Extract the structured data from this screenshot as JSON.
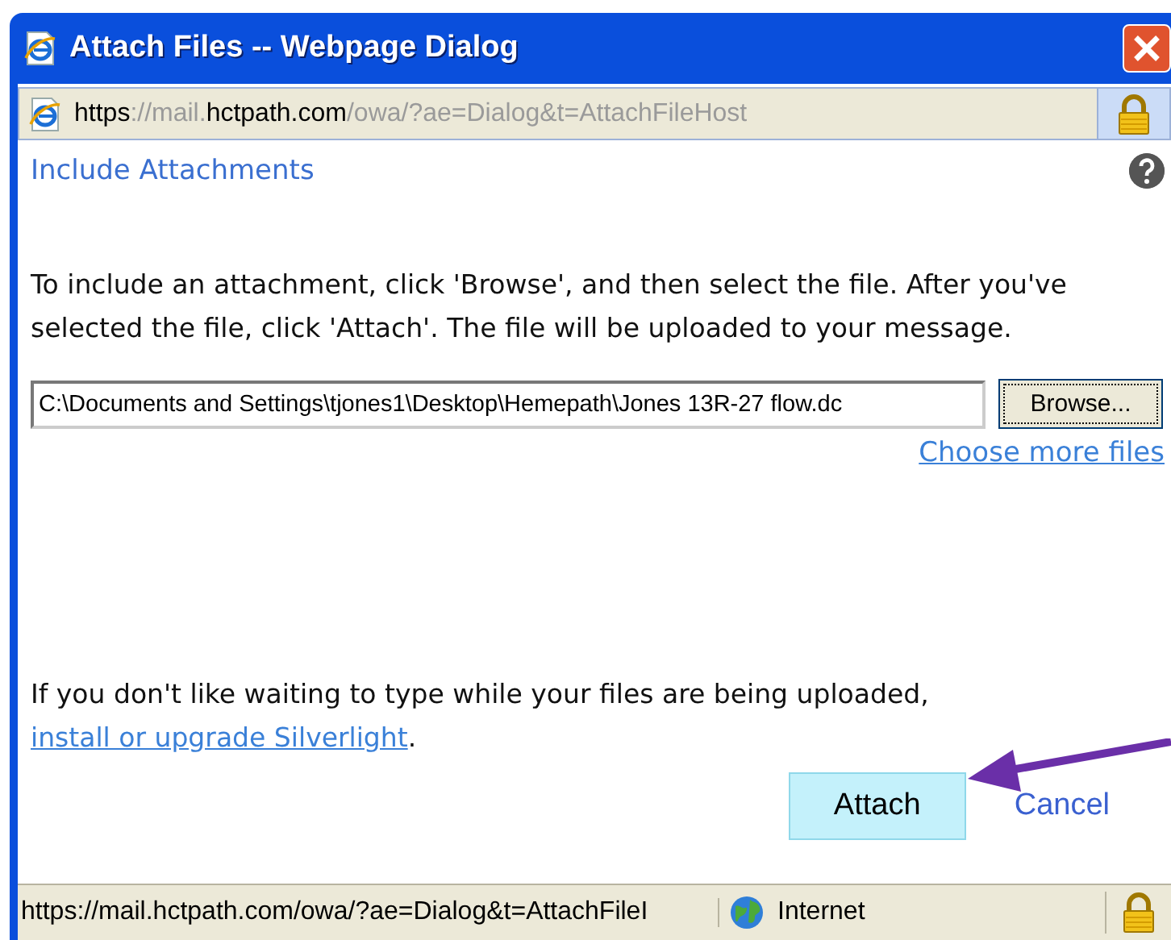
{
  "window": {
    "title": "Attach Files -- Webpage Dialog"
  },
  "address_bar": {
    "url_parts": [
      {
        "text": "https",
        "dim": false
      },
      {
        "text": "://mail.",
        "dim": true
      },
      {
        "text": "hctpath.com",
        "dim": false
      },
      {
        "text": "/owa/?ae=Dialog&t=AttachFileHost",
        "dim": true
      }
    ]
  },
  "header": {
    "title": "Include Attachments"
  },
  "instructions": "To include an attachment, click 'Browse', and then select the file. After you've selected the file, click 'Attach'. The file will be uploaded to your message.",
  "file_field": {
    "value": "C:\\Documents and Settings\\tjones1\\Desktop\\Hemepath\\Jones 13R-27 flow.dc",
    "button": "Browse..."
  },
  "more_files_link": "Choose more files",
  "silverlight_note": {
    "text": "If you don't like waiting to type while your files are being uploaded,",
    "link": "install or upgrade Silverlight",
    "end": "."
  },
  "buttons": [
    {
      "label": "Attach",
      "kind": "primary"
    },
    {
      "label": "Cancel",
      "kind": "link"
    }
  ],
  "status_bar": {
    "url": "https://mail.hctpath.com/owa/?ae=Dialog&t=AttachFileI",
    "zone": "Internet"
  }
}
